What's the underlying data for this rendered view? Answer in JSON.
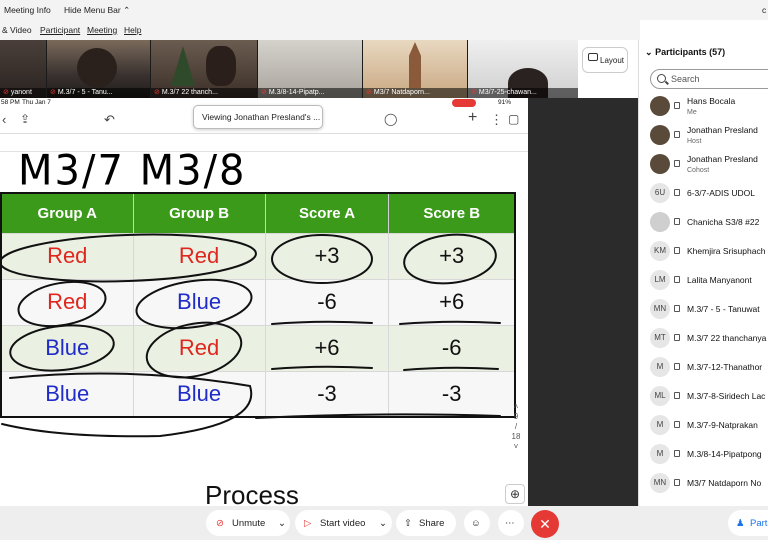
{
  "top_menu": {
    "meeting_info": "Meeting Info",
    "hide_menu_bar": "Hide Menu Bar",
    "right_char": "c"
  },
  "menu_bar": [
    "& Video",
    "Participant",
    "Meeting",
    "Help"
  ],
  "video_tiles": [
    {
      "name": "yanont"
    },
    {
      "name": "M.3/7 - 5 - Tanu..."
    },
    {
      "name": "M.3/7 22 thanch..."
    },
    {
      "name": "M.3/8-14-Pipatp..."
    },
    {
      "name": "M3/7 Natdaporn..."
    },
    {
      "name": "M3/7-25-chawan..."
    }
  ],
  "layout_button": "Layout",
  "status_bar": {
    "time": "58 PM",
    "date": "Thu Jan 7",
    "battery": "91%"
  },
  "viewing_tooltip": "Viewing Jonathan Presland's ...",
  "whiteboard": {
    "handwritten_title": "M3/7  M3/8",
    "table": {
      "headers": [
        "Group A",
        "Group B",
        "Score A",
        "Score B"
      ],
      "rows": [
        [
          "Red",
          "Red",
          "+3",
          "+3"
        ],
        [
          "Red",
          "Blue",
          "-6",
          "+6"
        ],
        [
          "Blue",
          "Red",
          "+6",
          "-6"
        ],
        [
          "Blue",
          "Blue",
          "-3",
          "-3"
        ]
      ],
      "colors": {
        "header_bg": "#3c9a1a",
        "red": "#e0271f",
        "blue": "#1f2cc8"
      }
    },
    "page_indicator": {
      "current": "9",
      "sep": "/",
      "total": "18"
    },
    "next_heading": "Process"
  },
  "participants": {
    "title": "Participants (57)",
    "search_placeholder": "Search",
    "list": [
      {
        "initials": "",
        "name": "Hans Bocala",
        "role": "Me",
        "avatar": "photo"
      },
      {
        "initials": "",
        "name": "Jonathan Presland",
        "role": "Host",
        "avatar": "photo"
      },
      {
        "initials": "",
        "name": "Jonathan Presland",
        "role": "Cohost",
        "avatar": "photo"
      },
      {
        "initials": "6U",
        "name": "6-3/7-ADIS UDOL",
        "role": ""
      },
      {
        "initials": "",
        "name": "Chanicha S3/8 #22",
        "role": "",
        "avatar": "gen"
      },
      {
        "initials": "KM",
        "name": "Khemjira Srisuphach",
        "role": ""
      },
      {
        "initials": "LM",
        "name": "Lalita Manyanont",
        "role": ""
      },
      {
        "initials": "MN",
        "name": "M.3/7 - 5 - Tanuwat",
        "role": ""
      },
      {
        "initials": "MT",
        "name": "M.3/7 22 thanchanya",
        "role": ""
      },
      {
        "initials": "M",
        "name": "M.3/7-12-Thanathor",
        "role": ""
      },
      {
        "initials": "ML",
        "name": "M.3/7-8-Siridech Lac",
        "role": ""
      },
      {
        "initials": "M",
        "name": "M.3/7-9-Natprakan",
        "role": ""
      },
      {
        "initials": "M",
        "name": "M.3/8-14-Pipatpong",
        "role": ""
      },
      {
        "initials": "MN",
        "name": "M3/7 Natdaporn No",
        "role": ""
      }
    ]
  },
  "toolbar": {
    "unmute": "Unmute",
    "start_video": "Start video",
    "share": "Share",
    "participants_short": "Part"
  }
}
